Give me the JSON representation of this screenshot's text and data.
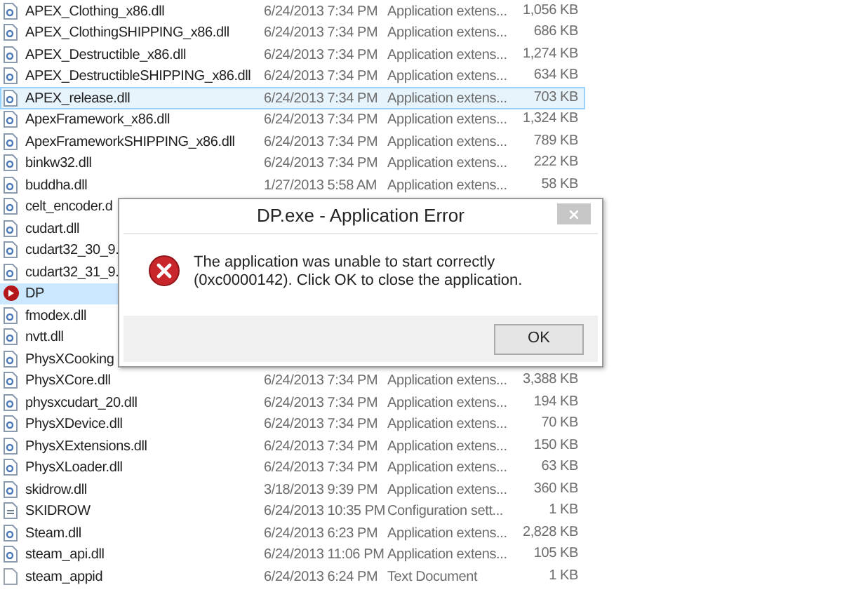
{
  "files": [
    {
      "name": "APEX_Clothing_x86.dll",
      "date": "6/24/2013 7:34 PM",
      "type": "Application extens...",
      "size": "1,056 KB",
      "kind": "dll",
      "selected": false,
      "hovered": false
    },
    {
      "name": "APEX_ClothingSHIPPING_x86.dll",
      "date": "6/24/2013 7:34 PM",
      "type": "Application extens...",
      "size": "686 KB",
      "kind": "dll",
      "selected": false,
      "hovered": false
    },
    {
      "name": "APEX_Destructible_x86.dll",
      "date": "6/24/2013 7:34 PM",
      "type": "Application extens...",
      "size": "1,274 KB",
      "kind": "dll",
      "selected": false,
      "hovered": false
    },
    {
      "name": "APEX_DestructibleSHIPPING_x86.dll",
      "date": "6/24/2013 7:34 PM",
      "type": "Application extens...",
      "size": "634 KB",
      "kind": "dll",
      "selected": false,
      "hovered": false
    },
    {
      "name": "APEX_release.dll",
      "date": "6/24/2013 7:34 PM",
      "type": "Application extens...",
      "size": "703 KB",
      "kind": "dll",
      "selected": false,
      "hovered": true
    },
    {
      "name": "ApexFramework_x86.dll",
      "date": "6/24/2013 7:34 PM",
      "type": "Application extens...",
      "size": "1,324 KB",
      "kind": "dll",
      "selected": false,
      "hovered": false
    },
    {
      "name": "ApexFrameworkSHIPPING_x86.dll",
      "date": "6/24/2013 7:34 PM",
      "type": "Application extens...",
      "size": "789 KB",
      "kind": "dll",
      "selected": false,
      "hovered": false
    },
    {
      "name": "binkw32.dll",
      "date": "6/24/2013 7:34 PM",
      "type": "Application extens...",
      "size": "222 KB",
      "kind": "dll",
      "selected": false,
      "hovered": false
    },
    {
      "name": "buddha.dll",
      "date": "1/27/2013 5:58 AM",
      "type": "Application extens...",
      "size": "58 KB",
      "kind": "dll",
      "selected": false,
      "hovered": false
    },
    {
      "name": "celt_encoder.d",
      "kind": "dll",
      "selected": false,
      "hovered": false
    },
    {
      "name": "cudart.dll",
      "kind": "dll",
      "selected": false,
      "hovered": false
    },
    {
      "name": "cudart32_30_9.",
      "kind": "dll",
      "selected": false,
      "hovered": false
    },
    {
      "name": "cudart32_31_9.",
      "kind": "dll",
      "selected": false,
      "hovered": false
    },
    {
      "name": "DP",
      "kind": "exe",
      "selected": true,
      "hovered": false
    },
    {
      "name": "fmodex.dll",
      "kind": "dll",
      "selected": false,
      "hovered": false
    },
    {
      "name": "nvtt.dll",
      "kind": "dll",
      "selected": false,
      "hovered": false
    },
    {
      "name": "PhysXCooking",
      "kind": "dll",
      "selected": false,
      "hovered": false
    },
    {
      "name": "PhysXCore.dll",
      "date": "6/24/2013 7:34 PM",
      "type": "Application extens...",
      "size": "3,388 KB",
      "kind": "dll",
      "selected": false,
      "hovered": false
    },
    {
      "name": "physxcudart_20.dll",
      "date": "6/24/2013 7:34 PM",
      "type": "Application extens...",
      "size": "194 KB",
      "kind": "dll",
      "selected": false,
      "hovered": false
    },
    {
      "name": "PhysXDevice.dll",
      "date": "6/24/2013 7:34 PM",
      "type": "Application extens...",
      "size": "70 KB",
      "kind": "dll",
      "selected": false,
      "hovered": false
    },
    {
      "name": "PhysXExtensions.dll",
      "date": "6/24/2013 7:34 PM",
      "type": "Application extens...",
      "size": "150 KB",
      "kind": "dll",
      "selected": false,
      "hovered": false
    },
    {
      "name": "PhysXLoader.dll",
      "date": "6/24/2013 7:34 PM",
      "type": "Application extens...",
      "size": "63 KB",
      "kind": "dll",
      "selected": false,
      "hovered": false
    },
    {
      "name": "skidrow.dll",
      "date": "3/18/2013 9:39 PM",
      "type": "Application extens...",
      "size": "360 KB",
      "kind": "dll",
      "selected": false,
      "hovered": false
    },
    {
      "name": "SKIDROW",
      "date": "6/24/2013 10:35 PM",
      "type": "Configuration sett...",
      "size": "1 KB",
      "kind": "config",
      "selected": false,
      "hovered": false
    },
    {
      "name": "Steam.dll",
      "date": "6/24/2013 6:23 PM",
      "type": "Application extens...",
      "size": "2,828 KB",
      "kind": "dll",
      "selected": false,
      "hovered": false
    },
    {
      "name": "steam_api.dll",
      "date": "6/24/2013 11:06 PM",
      "type": "Application extens...",
      "size": "105 KB",
      "kind": "dll",
      "selected": false,
      "hovered": false
    },
    {
      "name": "steam_appid",
      "date": "6/24/2013 6:24 PM",
      "type": "Text Document",
      "size": "1 KB",
      "kind": "text",
      "selected": false,
      "hovered": false
    }
  ],
  "dialog": {
    "title": "DP.exe - Application Error",
    "message": "The application was unable to start correctly (0xc0000142). Click OK to close the application.",
    "button": "OK"
  }
}
